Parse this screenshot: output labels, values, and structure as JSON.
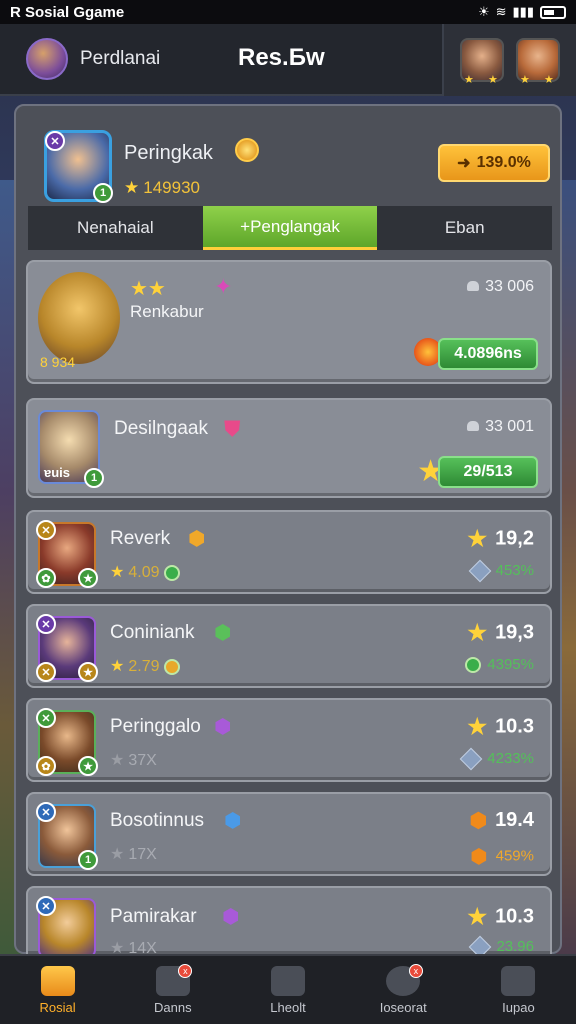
{
  "status_bar": {
    "title": "R Sosial Ggame"
  },
  "header": {
    "name": "Perdlanai",
    "title": "Res.Бw"
  },
  "profile": {
    "name": "Peringkak",
    "score": "149930",
    "pill": "139.0%"
  },
  "tabs": [
    {
      "label": "Nenahaial",
      "active": false
    },
    {
      "label": "+Penglangak",
      "active": true
    },
    {
      "label": "Eban",
      "active": false
    }
  ],
  "rows": [
    {
      "name": "Renkabur",
      "level_text": "8 934",
      "silver": "33 006",
      "pill": "4.0896ns"
    },
    {
      "name": "Desilngaak",
      "level_text": "ɐuis",
      "silver": "33 001",
      "pill": "29/513"
    },
    {
      "name": "Reverk",
      "sub": "4.09",
      "top": "19,2",
      "bot": "453%"
    },
    {
      "name": "Coniniank",
      "sub": "2.79",
      "top": "19,3",
      "bot": "4395%"
    },
    {
      "name": "Peringgalo",
      "sub": "37X",
      "top": "10.3",
      "bot": "4233%"
    },
    {
      "name": "Bosotinnus",
      "sub": "17X",
      "top": "19.4",
      "bot": "459%"
    },
    {
      "name": "Pamirakar",
      "sub": "14X",
      "top": "10.3",
      "bot": "23.96"
    }
  ],
  "nav": [
    {
      "label": "Rosial",
      "active": true,
      "badge": ""
    },
    {
      "label": "Danns",
      "active": false,
      "badge": "x"
    },
    {
      "label": "Lheolt",
      "active": false,
      "badge": ""
    },
    {
      "label": "Ioseorat",
      "active": false,
      "badge": "x"
    },
    {
      "label": "Iupao",
      "active": false,
      "badge": ""
    }
  ],
  "colors": {
    "accent_green": "#5ea62a",
    "accent_gold": "#ffc23a",
    "star": "#ffd23a"
  }
}
